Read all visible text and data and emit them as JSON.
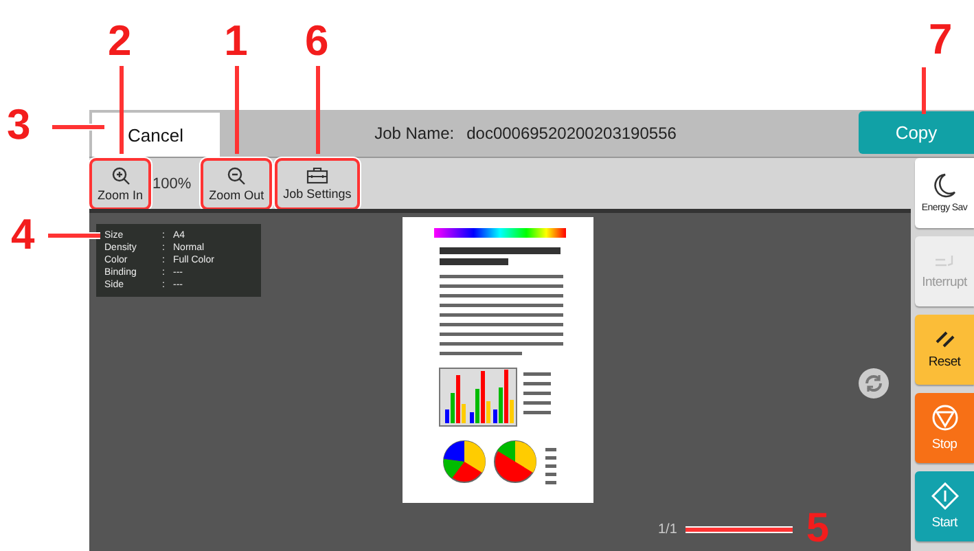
{
  "top_bar": {
    "cancel_button": {
      "label": "Cancel",
      "callout": "3"
    },
    "job_name_label": "Job Name:",
    "job_name": "doc00069520200203190556",
    "copy_button": {
      "label": "Copy",
      "callout": "7"
    }
  },
  "toolbar": {
    "items": [
      {
        "kind": "zoom_in",
        "label": "Zoom In",
        "callout": "2"
      },
      {
        "kind": "zoom_level",
        "label": "100%"
      },
      {
        "kind": "zoom_out",
        "label": "Zoom Out",
        "callout": "1"
      },
      {
        "kind": "job_settings",
        "label": "Job Settings",
        "callout": "6"
      }
    ]
  },
  "preview": {
    "info_panel": {
      "callout": "4",
      "separator": ":",
      "rows": [
        {
          "label": "Size",
          "value": "A4"
        },
        {
          "label": "Density",
          "value": "Normal"
        },
        {
          "label": "Color",
          "value": "Full Color"
        },
        {
          "label": "Binding",
          "value": "---"
        },
        {
          "label": "Side",
          "value": "---"
        }
      ]
    },
    "page_counter": {
      "label": "1/1",
      "callout": "5"
    }
  },
  "sidebar": {
    "items": [
      {
        "kind": "energy",
        "label": "Energy Sav",
        "disabled": false
      },
      {
        "kind": "interrupt",
        "label": "Interrupt",
        "disabled": true
      },
      {
        "kind": "reset",
        "label": "Reset",
        "disabled": false
      },
      {
        "kind": "stop",
        "label": "Stop",
        "disabled": false
      },
      {
        "kind": "start",
        "label": "Start",
        "disabled": false
      }
    ]
  }
}
